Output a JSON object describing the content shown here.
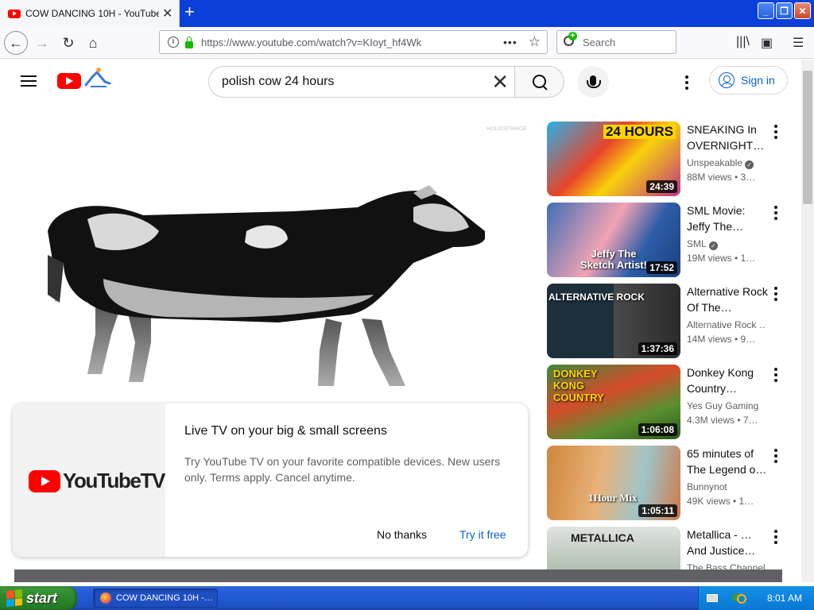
{
  "browser": {
    "tab_title": "COW DANCING 10H - YouTube",
    "tab_close": "✕",
    "new_tab": "+",
    "url": "https://www.youtube.com/watch?v=KIoyt_hf4Wk",
    "search_placeholder": "Search",
    "page_actions": "•••",
    "bookmark_star": "☆",
    "window_buttons": {
      "minimize": "_",
      "maximize": "❐",
      "close": "✕"
    },
    "nav_icons": {
      "back": "←",
      "forward": "→",
      "reload": "↻",
      "home": "⌂",
      "library": "|||\\",
      "sidebar": "▣",
      "menu": "☰"
    }
  },
  "youtube": {
    "search_query": "polish cow 24 hours",
    "clear_icon": "✕",
    "sign_in_label": "Sign in",
    "brand_color": "#ff0000",
    "link_color": "#065fd4",
    "player": {
      "watermark": "HOLOSPIRAGE"
    },
    "promo": {
      "logo_text": "YouTubeTV",
      "title": "Live TV on your big & small screens",
      "description": "Try YouTube TV on your favorite compatible devices. New users only. Terms apply. Cancel anytime.",
      "dismiss_label": "No thanks",
      "accept_label": "Try it free"
    },
    "recommendations": [
      {
        "title": "SNEAKING In OVERNIGHT…",
        "channel": "Unspeakable",
        "verified": true,
        "meta": "88M views • 3…",
        "duration": "24:39",
        "overlay": "24 HOURS"
      },
      {
        "title": "SML Movie: Jeffy The…",
        "channel": "SML",
        "verified": true,
        "meta": "19M views • 1…",
        "duration": "17:52",
        "overlay": "Jeffy The Sketch Artist!"
      },
      {
        "title": "Alternative Rock Of The…",
        "channel": "Alternative Rock …",
        "verified": false,
        "meta": "14M views • 9…",
        "duration": "1:37:36",
        "overlay": "ALTERNATIVE ROCK"
      },
      {
        "title": "Donkey Kong Country…",
        "channel": "Yes Guy Gaming",
        "verified": false,
        "meta": "4.3M views • 7…",
        "duration": "1:06:08",
        "overlay": "DONKEY KONG COUNTRY"
      },
      {
        "title": "65 minutes of The Legend o…",
        "channel": "Bunnynot",
        "verified": false,
        "meta": "49K views • 1…",
        "duration": "1:05:11",
        "overlay": "1Hour Mix"
      },
      {
        "title": "Metallica - …And Justice…",
        "channel": "The Bass Channel",
        "verified": false,
        "meta": "",
        "duration": "",
        "overlay": "METALLICA"
      }
    ]
  },
  "taskbar": {
    "start_label": "start",
    "task_label": "COW DANCING 10H -…",
    "clock": "8:01 AM"
  }
}
